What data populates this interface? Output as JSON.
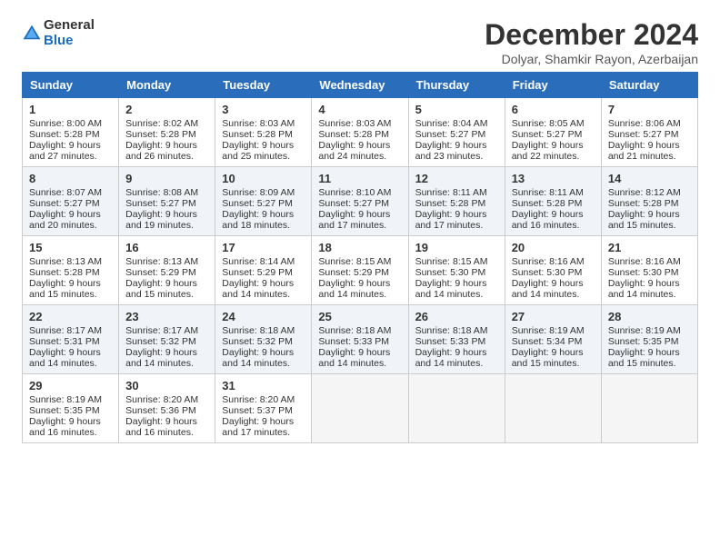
{
  "header": {
    "logo_general": "General",
    "logo_blue": "Blue",
    "title": "December 2024",
    "subtitle": "Dolyar, Shamkir Rayon, Azerbaijan"
  },
  "weekdays": [
    "Sunday",
    "Monday",
    "Tuesday",
    "Wednesday",
    "Thursday",
    "Friday",
    "Saturday"
  ],
  "weeks": [
    [
      {
        "day": 1,
        "lines": [
          "Sunrise: 8:00 AM",
          "Sunset: 5:28 PM",
          "Daylight: 9 hours",
          "and 27 minutes."
        ]
      },
      {
        "day": 2,
        "lines": [
          "Sunrise: 8:02 AM",
          "Sunset: 5:28 PM",
          "Daylight: 9 hours",
          "and 26 minutes."
        ]
      },
      {
        "day": 3,
        "lines": [
          "Sunrise: 8:03 AM",
          "Sunset: 5:28 PM",
          "Daylight: 9 hours",
          "and 25 minutes."
        ]
      },
      {
        "day": 4,
        "lines": [
          "Sunrise: 8:03 AM",
          "Sunset: 5:28 PM",
          "Daylight: 9 hours",
          "and 24 minutes."
        ]
      },
      {
        "day": 5,
        "lines": [
          "Sunrise: 8:04 AM",
          "Sunset: 5:27 PM",
          "Daylight: 9 hours",
          "and 23 minutes."
        ]
      },
      {
        "day": 6,
        "lines": [
          "Sunrise: 8:05 AM",
          "Sunset: 5:27 PM",
          "Daylight: 9 hours",
          "and 22 minutes."
        ]
      },
      {
        "day": 7,
        "lines": [
          "Sunrise: 8:06 AM",
          "Sunset: 5:27 PM",
          "Daylight: 9 hours",
          "and 21 minutes."
        ]
      }
    ],
    [
      {
        "day": 8,
        "lines": [
          "Sunrise: 8:07 AM",
          "Sunset: 5:27 PM",
          "Daylight: 9 hours",
          "and 20 minutes."
        ]
      },
      {
        "day": 9,
        "lines": [
          "Sunrise: 8:08 AM",
          "Sunset: 5:27 PM",
          "Daylight: 9 hours",
          "and 19 minutes."
        ]
      },
      {
        "day": 10,
        "lines": [
          "Sunrise: 8:09 AM",
          "Sunset: 5:27 PM",
          "Daylight: 9 hours",
          "and 18 minutes."
        ]
      },
      {
        "day": 11,
        "lines": [
          "Sunrise: 8:10 AM",
          "Sunset: 5:27 PM",
          "Daylight: 9 hours",
          "and 17 minutes."
        ]
      },
      {
        "day": 12,
        "lines": [
          "Sunrise: 8:11 AM",
          "Sunset: 5:28 PM",
          "Daylight: 9 hours",
          "and 17 minutes."
        ]
      },
      {
        "day": 13,
        "lines": [
          "Sunrise: 8:11 AM",
          "Sunset: 5:28 PM",
          "Daylight: 9 hours",
          "and 16 minutes."
        ]
      },
      {
        "day": 14,
        "lines": [
          "Sunrise: 8:12 AM",
          "Sunset: 5:28 PM",
          "Daylight: 9 hours",
          "and 15 minutes."
        ]
      }
    ],
    [
      {
        "day": 15,
        "lines": [
          "Sunrise: 8:13 AM",
          "Sunset: 5:28 PM",
          "Daylight: 9 hours",
          "and 15 minutes."
        ]
      },
      {
        "day": 16,
        "lines": [
          "Sunrise: 8:13 AM",
          "Sunset: 5:29 PM",
          "Daylight: 9 hours",
          "and 15 minutes."
        ]
      },
      {
        "day": 17,
        "lines": [
          "Sunrise: 8:14 AM",
          "Sunset: 5:29 PM",
          "Daylight: 9 hours",
          "and 14 minutes."
        ]
      },
      {
        "day": 18,
        "lines": [
          "Sunrise: 8:15 AM",
          "Sunset: 5:29 PM",
          "Daylight: 9 hours",
          "and 14 minutes."
        ]
      },
      {
        "day": 19,
        "lines": [
          "Sunrise: 8:15 AM",
          "Sunset: 5:30 PM",
          "Daylight: 9 hours",
          "and 14 minutes."
        ]
      },
      {
        "day": 20,
        "lines": [
          "Sunrise: 8:16 AM",
          "Sunset: 5:30 PM",
          "Daylight: 9 hours",
          "and 14 minutes."
        ]
      },
      {
        "day": 21,
        "lines": [
          "Sunrise: 8:16 AM",
          "Sunset: 5:30 PM",
          "Daylight: 9 hours",
          "and 14 minutes."
        ]
      }
    ],
    [
      {
        "day": 22,
        "lines": [
          "Sunrise: 8:17 AM",
          "Sunset: 5:31 PM",
          "Daylight: 9 hours",
          "and 14 minutes."
        ]
      },
      {
        "day": 23,
        "lines": [
          "Sunrise: 8:17 AM",
          "Sunset: 5:32 PM",
          "Daylight: 9 hours",
          "and 14 minutes."
        ]
      },
      {
        "day": 24,
        "lines": [
          "Sunrise: 8:18 AM",
          "Sunset: 5:32 PM",
          "Daylight: 9 hours",
          "and 14 minutes."
        ]
      },
      {
        "day": 25,
        "lines": [
          "Sunrise: 8:18 AM",
          "Sunset: 5:33 PM",
          "Daylight: 9 hours",
          "and 14 minutes."
        ]
      },
      {
        "day": 26,
        "lines": [
          "Sunrise: 8:18 AM",
          "Sunset: 5:33 PM",
          "Daylight: 9 hours",
          "and 14 minutes."
        ]
      },
      {
        "day": 27,
        "lines": [
          "Sunrise: 8:19 AM",
          "Sunset: 5:34 PM",
          "Daylight: 9 hours",
          "and 15 minutes."
        ]
      },
      {
        "day": 28,
        "lines": [
          "Sunrise: 8:19 AM",
          "Sunset: 5:35 PM",
          "Daylight: 9 hours",
          "and 15 minutes."
        ]
      }
    ],
    [
      {
        "day": 29,
        "lines": [
          "Sunrise: 8:19 AM",
          "Sunset: 5:35 PM",
          "Daylight: 9 hours",
          "and 16 minutes."
        ]
      },
      {
        "day": 30,
        "lines": [
          "Sunrise: 8:20 AM",
          "Sunset: 5:36 PM",
          "Daylight: 9 hours",
          "and 16 minutes."
        ]
      },
      {
        "day": 31,
        "lines": [
          "Sunrise: 8:20 AM",
          "Sunset: 5:37 PM",
          "Daylight: 9 hours",
          "and 17 minutes."
        ]
      },
      null,
      null,
      null,
      null
    ]
  ]
}
